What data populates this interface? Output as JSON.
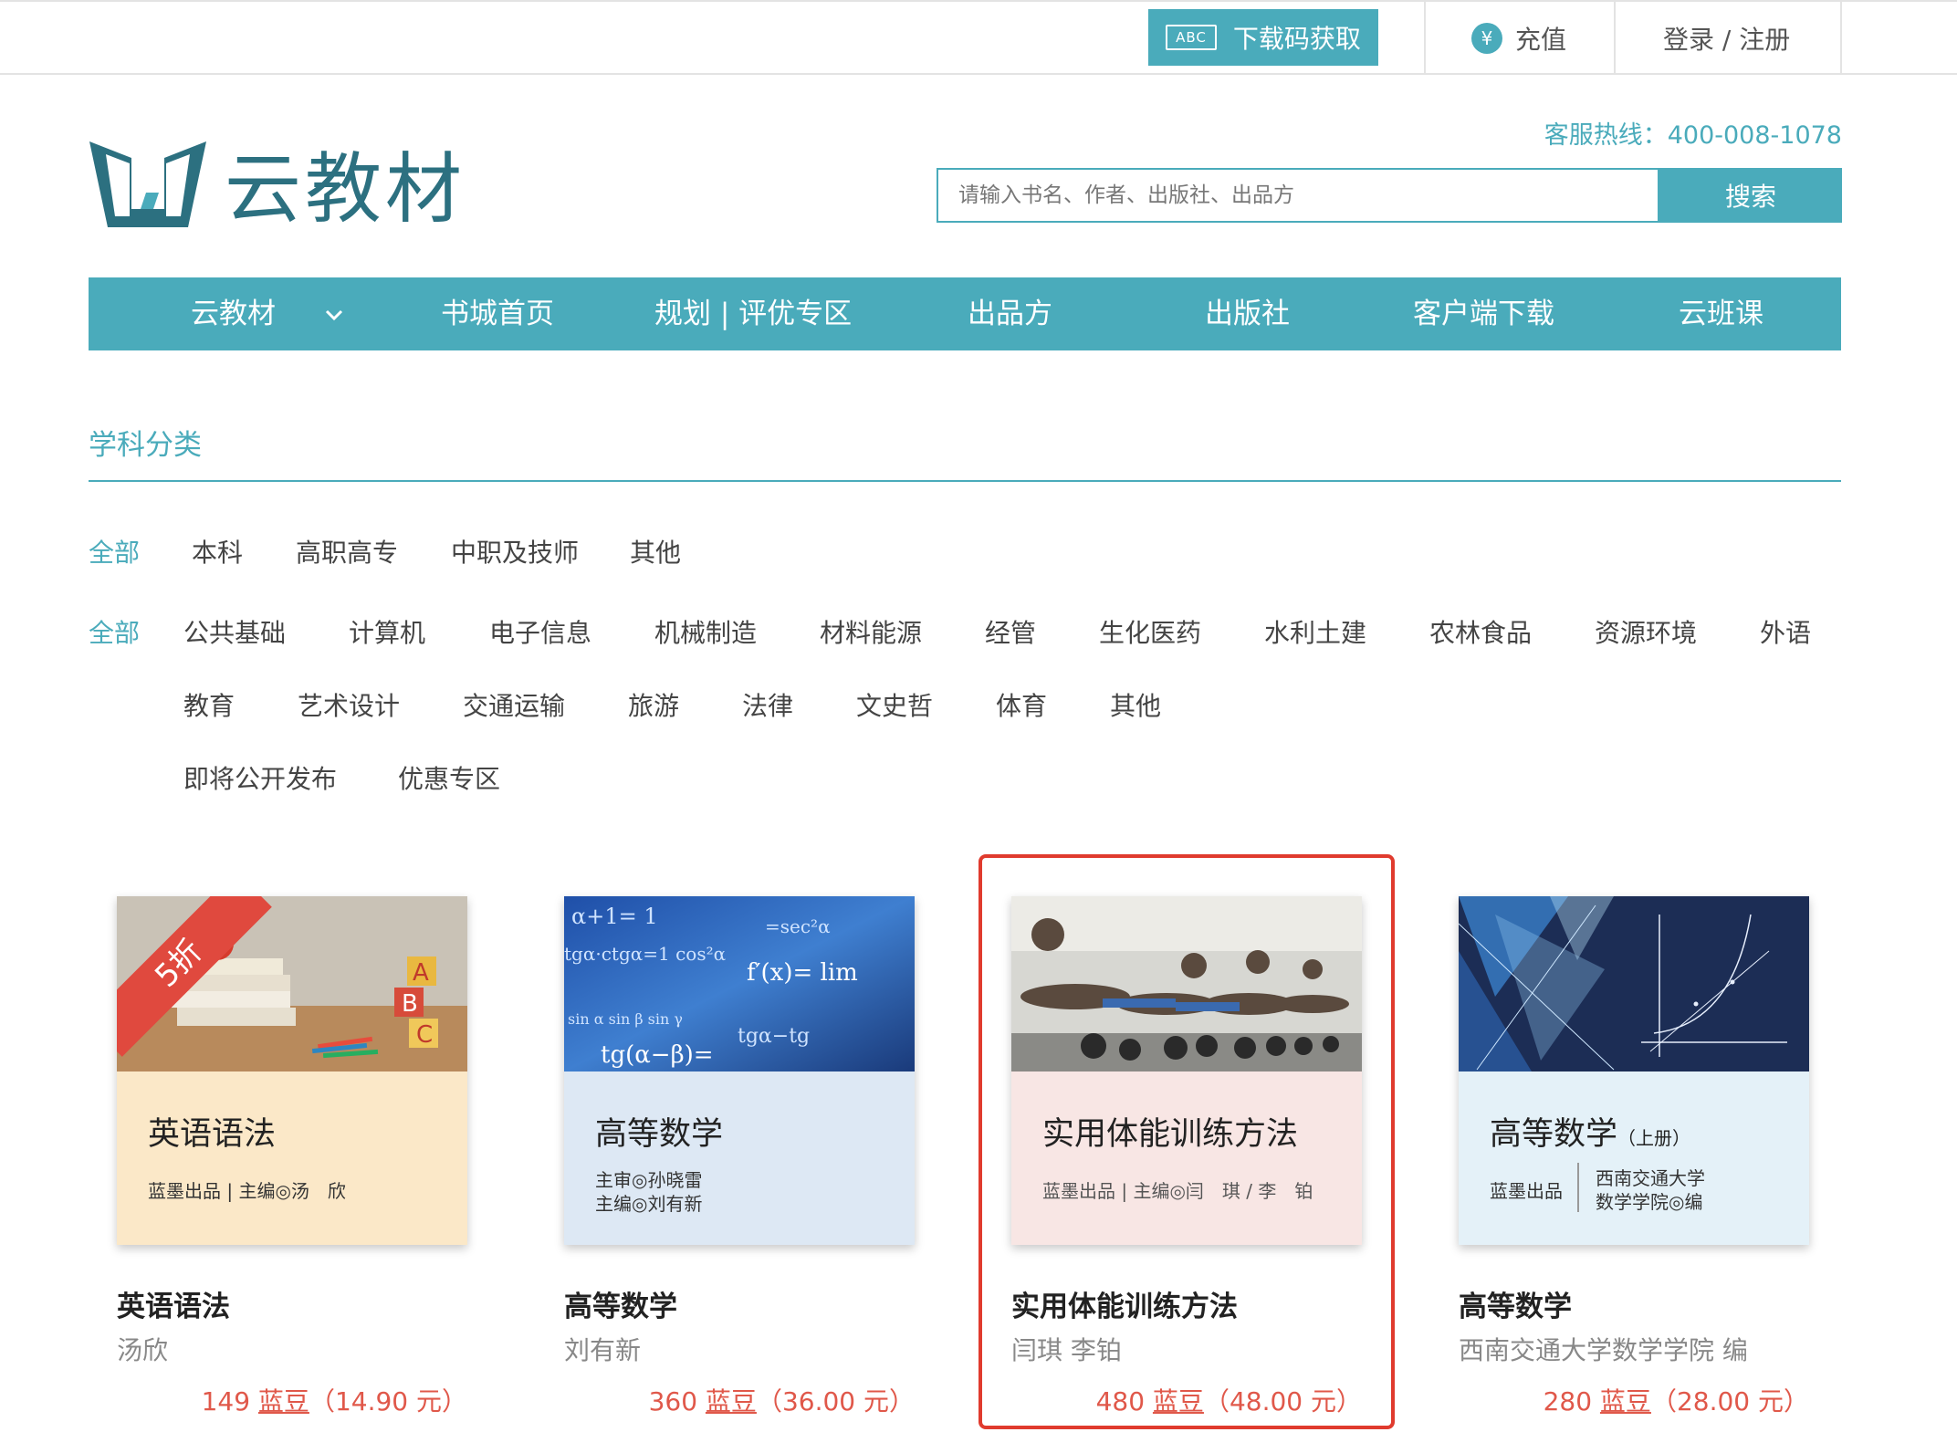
{
  "topbar": {
    "code_badge": "ABC",
    "code_button": "下载码获取",
    "recharge_symbol": "¥",
    "recharge": "充值",
    "login": "登录 / 注册"
  },
  "header": {
    "logo_text": "云教材",
    "hotline": "客服热线：400-008-1078",
    "search_placeholder": "请输入书名、作者、出版社、出品方",
    "search_button": "搜索"
  },
  "nav": {
    "items": [
      "云教材",
      "书城首页",
      "规划 | 评优专区",
      "出品方",
      "出版社",
      "客户端下载",
      "云班课"
    ],
    "dropdown_icon": "chevron-down-icon"
  },
  "category": {
    "title": "学科分类",
    "levels": [
      "全部",
      "本科",
      "高职高专",
      "中职及技师",
      "其他"
    ],
    "subjects_all": "全部",
    "subjects": [
      "公共基础",
      "计算机",
      "电子信息",
      "机械制造",
      "材料能源",
      "经管",
      "生化医药",
      "水利土建",
      "农林食品",
      "资源环境",
      "外语",
      "教育",
      "艺术设计",
      "交通运输",
      "旅游",
      "法律",
      "文史哲",
      "体育",
      "其他",
      "即将公开发布",
      "优惠专区"
    ]
  },
  "books": [
    {
      "ribbon": "5折",
      "cover_title": "英语语法",
      "cover_sub1": "蓝墨出品 | 主编◎汤　欣",
      "cover_sub2": "",
      "title": "英语语法",
      "author": "汤欣",
      "price_num": "149",
      "price_unit": "蓝豆",
      "price_yuan": "（14.90 元）",
      "cover_color": "#fbe8c8"
    },
    {
      "ribbon": "",
      "cover_title": "高等数学",
      "cover_sub1": "主审◎孙晓雷",
      "cover_sub2": "主编◎刘有新",
      "title": "高等数学",
      "author": "刘有新",
      "price_num": "360",
      "price_unit": "蓝豆",
      "price_yuan": "（36.00 元）",
      "cover_color": "#dde8f4"
    },
    {
      "ribbon": "",
      "cover_title": "实用体能训练方法",
      "cover_sub1": "蓝墨出品 | 主编◎闫　琪 / 李　铂",
      "cover_sub2": "",
      "title": "实用体能训练方法",
      "author": "闫琪 李铂",
      "price_num": "480",
      "price_unit": "蓝豆",
      "price_yuan": "（48.00 元）",
      "cover_color": "#f8e6e4"
    },
    {
      "ribbon": "",
      "cover_title": "高等数学",
      "cover_title_small": "（上册）",
      "cover_sub1": "蓝墨出品",
      "cover_sub2": "西南交通大学",
      "cover_sub3": "数学学院◎编",
      "title": "高等数学",
      "author": "西南交通大学数学学院 编",
      "price_num": "280",
      "price_unit": "蓝豆",
      "price_yuan": "（28.00 元）",
      "cover_color": "#e4f1f8"
    }
  ]
}
